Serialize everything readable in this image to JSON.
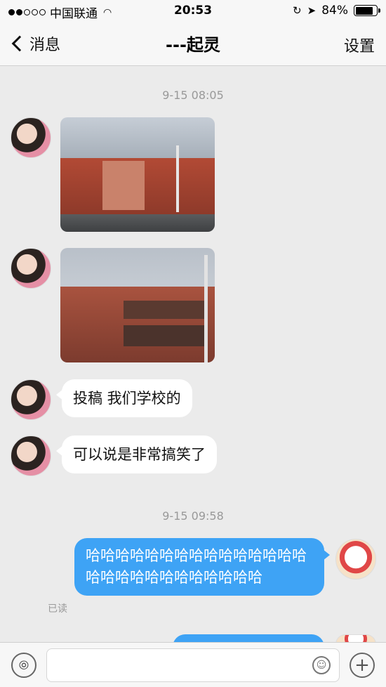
{
  "status_bar": {
    "carrier": "中国联通",
    "time": "20:53",
    "battery": "84%",
    "battery_level": 0.84
  },
  "nav": {
    "back_label": "消息",
    "title": "---起灵",
    "settings_label": "设置"
  },
  "messages": {
    "timestamp_1": "9-15 08:05",
    "text_1": "投稿 我们学校的",
    "text_2": "可以说是非常搞笑了",
    "timestamp_2": "9-15 09:58",
    "outgoing_text": "哈哈哈哈哈哈哈哈哈哈哈哈哈哈哈哈哈哈哈哈哈哈哈哈哈哈哈",
    "read_status": "已读"
  },
  "icons": {
    "back": "chevron-left-icon",
    "wifi": "wifi-icon",
    "location": "location-arrow-icon",
    "lock_rotation": "orientation-lock-icon",
    "voice": "voice-icon",
    "emoji": "emoji-icon",
    "add": "plus-icon"
  },
  "colors": {
    "outgoing_bubble": "#3ea3f5",
    "incoming_bubble": "#ffffff",
    "background": "#ebebeb"
  }
}
